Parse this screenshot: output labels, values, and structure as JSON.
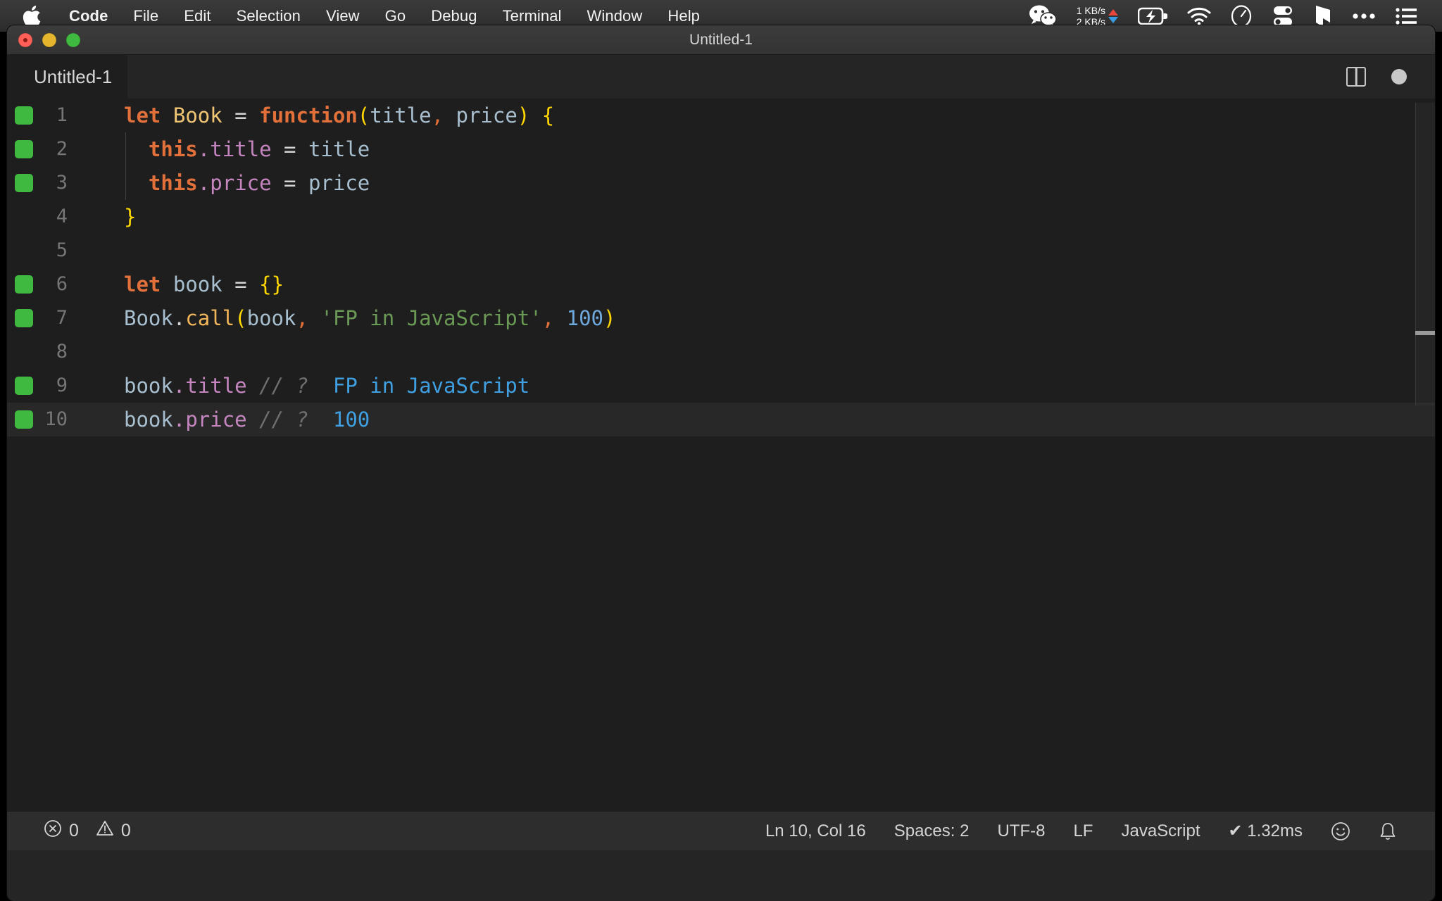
{
  "menubar": {
    "apple_icon": "apple-logo-icon",
    "items": [
      {
        "label": "Code",
        "bold": true
      },
      {
        "label": "File",
        "bold": false
      },
      {
        "label": "Edit",
        "bold": false
      },
      {
        "label": "Selection",
        "bold": false
      },
      {
        "label": "View",
        "bold": false
      },
      {
        "label": "Go",
        "bold": false
      },
      {
        "label": "Debug",
        "bold": false
      },
      {
        "label": "Terminal",
        "bold": false
      },
      {
        "label": "Window",
        "bold": false
      },
      {
        "label": "Help",
        "bold": false
      }
    ],
    "tray": {
      "wechat_icon": "wechat-icon",
      "net_up": "1 KB/s",
      "net_down": "2 KB/s",
      "battery_icon": "battery-charging-icon",
      "wifi_icon": "wifi-icon",
      "clock_icon": "clock-icon",
      "toggles_icon": "toggles-icon",
      "bookmark_icon": "bookmark-icon",
      "more_icon": "ellipsis-icon",
      "list_icon": "control-center-list-icon"
    }
  },
  "window": {
    "title": "Untitled-1",
    "traffic_lights": {
      "close": "close-button",
      "minimize": "minimize-button",
      "zoom": "zoom-button"
    }
  },
  "tabbar": {
    "tab_label": "Untitled-1",
    "split_editor_icon": "split-editor-icon",
    "dirty_indicator": "unsaved-changes-dot"
  },
  "editor": {
    "active_line": 10,
    "indent_guide_lines": [
      2,
      3
    ],
    "lines": [
      {
        "n": "1",
        "marked": true,
        "tokens": [
          {
            "t": "let",
            "c": "t-key"
          },
          {
            "t": " ",
            "c": "t-op"
          },
          {
            "t": "Book",
            "c": "t-fnname"
          },
          {
            "t": " ",
            "c": "t-op"
          },
          {
            "t": "=",
            "c": "t-op"
          },
          {
            "t": " ",
            "c": "t-op"
          },
          {
            "t": "function",
            "c": "t-key"
          },
          {
            "t": "(",
            "c": "t-brk"
          },
          {
            "t": "title",
            "c": "t-var"
          },
          {
            "t": ",",
            "c": "t-punc"
          },
          {
            "t": " price",
            "c": "t-var"
          },
          {
            "t": ")",
            "c": "t-brk"
          },
          {
            "t": " ",
            "c": "t-op"
          },
          {
            "t": "{",
            "c": "t-brk"
          }
        ]
      },
      {
        "n": "2",
        "marked": true,
        "tokens": [
          {
            "t": "  ",
            "c": "t-op"
          },
          {
            "t": "this",
            "c": "t-key"
          },
          {
            "t": ".",
            "c": "t-prop"
          },
          {
            "t": "title",
            "c": "t-prop"
          },
          {
            "t": " ",
            "c": "t-op"
          },
          {
            "t": "=",
            "c": "t-op"
          },
          {
            "t": " ",
            "c": "t-op"
          },
          {
            "t": "title",
            "c": "t-var"
          }
        ]
      },
      {
        "n": "3",
        "marked": true,
        "tokens": [
          {
            "t": "  ",
            "c": "t-op"
          },
          {
            "t": "this",
            "c": "t-key"
          },
          {
            "t": ".",
            "c": "t-prop"
          },
          {
            "t": "price",
            "c": "t-prop"
          },
          {
            "t": " ",
            "c": "t-op"
          },
          {
            "t": "=",
            "c": "t-op"
          },
          {
            "t": " ",
            "c": "t-op"
          },
          {
            "t": "price",
            "c": "t-var"
          }
        ]
      },
      {
        "n": "4",
        "marked": false,
        "tokens": [
          {
            "t": "}",
            "c": "t-brk"
          }
        ]
      },
      {
        "n": "5",
        "marked": false,
        "tokens": []
      },
      {
        "n": "6",
        "marked": true,
        "tokens": [
          {
            "t": "let",
            "c": "t-key"
          },
          {
            "t": " ",
            "c": "t-op"
          },
          {
            "t": "book",
            "c": "t-var"
          },
          {
            "t": " ",
            "c": "t-op"
          },
          {
            "t": "=",
            "c": "t-op"
          },
          {
            "t": " ",
            "c": "t-op"
          },
          {
            "t": "{}",
            "c": "t-brk"
          }
        ]
      },
      {
        "n": "7",
        "marked": true,
        "tokens": [
          {
            "t": "Book",
            "c": "t-var"
          },
          {
            "t": ".",
            "c": "t-op"
          },
          {
            "t": "call",
            "c": "t-call"
          },
          {
            "t": "(",
            "c": "t-brk"
          },
          {
            "t": "book",
            "c": "t-var"
          },
          {
            "t": ",",
            "c": "t-punc"
          },
          {
            "t": " ",
            "c": "t-op"
          },
          {
            "t": "'FP in JavaScript'",
            "c": "t-str"
          },
          {
            "t": ",",
            "c": "t-punc"
          },
          {
            "t": " ",
            "c": "t-op"
          },
          {
            "t": "100",
            "c": "t-num"
          },
          {
            "t": ")",
            "c": "t-brk"
          }
        ]
      },
      {
        "n": "8",
        "marked": false,
        "tokens": []
      },
      {
        "n": "9",
        "marked": true,
        "tokens": [
          {
            "t": "book",
            "c": "t-var"
          },
          {
            "t": ".",
            "c": "t-prop"
          },
          {
            "t": "title",
            "c": "t-prop"
          },
          {
            "t": " ",
            "c": "t-op"
          },
          {
            "t": "// ?",
            "c": "t-comment"
          },
          {
            "t": "  ",
            "c": "t-op"
          },
          {
            "t": "FP in JavaScript",
            "c": "t-result"
          }
        ]
      },
      {
        "n": "10",
        "marked": true,
        "tokens": [
          {
            "t": "book",
            "c": "t-var"
          },
          {
            "t": ".",
            "c": "t-prop"
          },
          {
            "t": "price",
            "c": "t-prop"
          },
          {
            "t": " ",
            "c": "t-op"
          },
          {
            "t": "// ?",
            "c": "t-comment"
          },
          {
            "t": "  ",
            "c": "t-op"
          },
          {
            "t": "100",
            "c": "t-result"
          }
        ]
      }
    ]
  },
  "statusbar": {
    "error_icon": "error-circle-icon",
    "error_count": "0",
    "warning_icon": "warning-triangle-icon",
    "warning_count": "0",
    "cursor_position": "Ln 10, Col 16",
    "indentation": "Spaces: 2",
    "encoding": "UTF-8",
    "eol": "LF",
    "language": "JavaScript",
    "quokka_status": "✔ 1.32ms",
    "feedback_icon": "smiley-icon",
    "notifications_icon": "bell-icon"
  },
  "colors": {
    "editor_bg": "#1e1e1e",
    "chrome_bg": "#252526",
    "statusbar_bg": "#2d2d2d",
    "gutter_mark": "#3fb93f",
    "result_blue": "#3f9fe0",
    "string_green": "#6a9955",
    "keyword_orange": "#e2703a",
    "bracket_yellow": "#ffd700"
  }
}
